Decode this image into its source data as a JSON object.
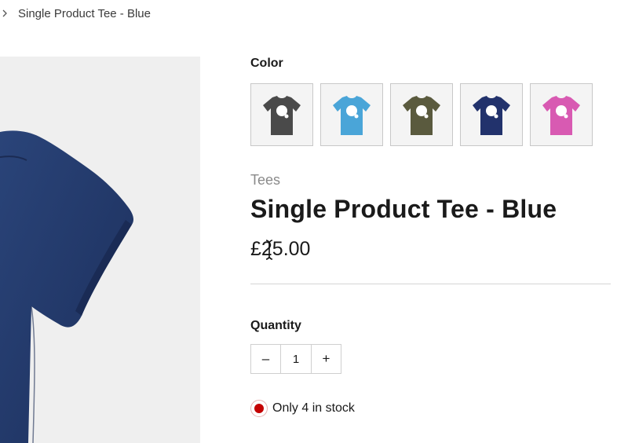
{
  "breadcrumb": {
    "current": "Single Product Tee - Blue"
  },
  "product_image": {
    "alt": "Blue t-shirt",
    "shirt_color": "#233a6c",
    "background": "#efefef"
  },
  "color_selector": {
    "label": "Color",
    "swatches": [
      {
        "name": "Gray",
        "color": "#4a4a4a"
      },
      {
        "name": "Blue (light)",
        "color": "#4aa5d8"
      },
      {
        "name": "Green",
        "color": "#5a5a3e"
      },
      {
        "name": "Navy",
        "color": "#22326c"
      },
      {
        "name": "Pink",
        "color": "#d85ab2"
      }
    ]
  },
  "product": {
    "category": "Tees",
    "title": "Single Product Tee - Blue",
    "price": "£25.00"
  },
  "quantity": {
    "label": "Quantity",
    "decrement": "–",
    "value": "1",
    "increment": "+"
  },
  "stock": {
    "text": "Only 4 in stock",
    "status_color": "#c40000"
  },
  "icons": {
    "breadcrumb_separator": "chevron-right-icon",
    "cursor": "text-cursor-icon"
  }
}
